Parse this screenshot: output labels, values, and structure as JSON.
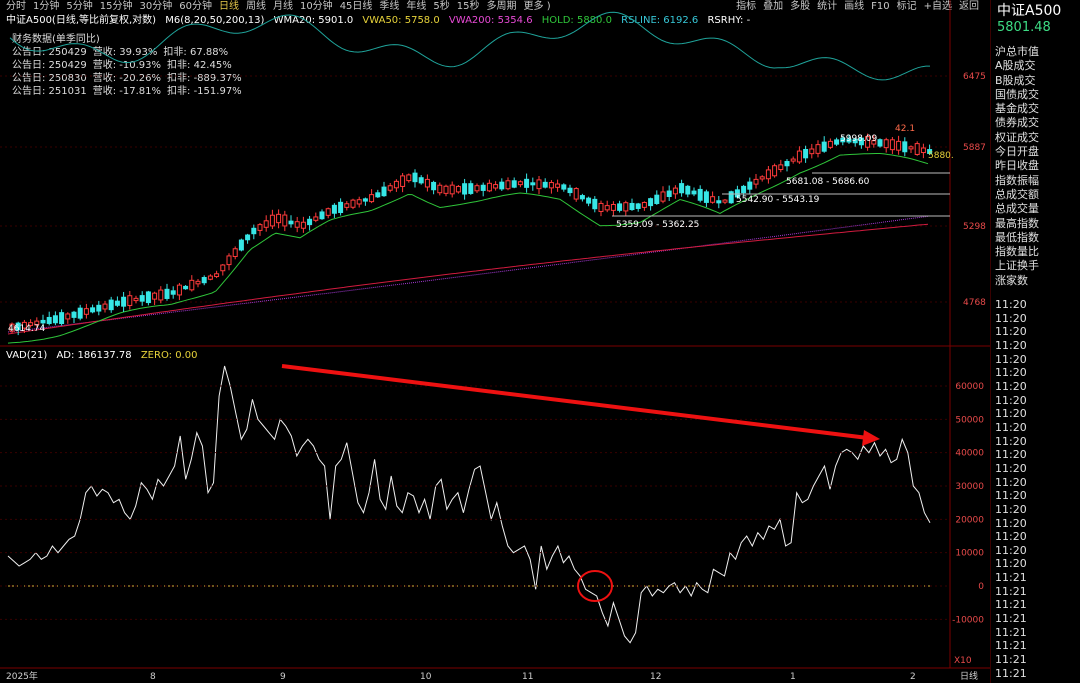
{
  "toolbar": {
    "left": [
      "分时",
      "1分钟",
      "5分钟",
      "15分钟",
      "30分钟",
      "60分钟",
      "日线",
      "周线",
      "月线",
      "10分钟",
      "45日线",
      "季线",
      "年线",
      "5秒",
      "15秒",
      "多周期",
      "更多 )"
    ],
    "active": "日线",
    "right": [
      "指标",
      "叠加",
      "多股",
      "统计",
      "画线",
      "F10",
      "标记",
      "+自选",
      "返回"
    ]
  },
  "info": {
    "name": "中证A500(日线,等比前复权,对数)",
    "m6": "M6(8,20,50,200,13)",
    "wma20": "WMA20: 5901.0",
    "vwa50": "VWA50: 5758.0",
    "vwa200": "VWA200: 5354.6",
    "hold": "HOLD: 5880.0",
    "rsline": "RSLINE: 6192.6",
    "rsrhy": "RSRHY: -"
  },
  "financial": {
    "header": "财务数据(单季同比)",
    "rows": [
      [
        "公告日: 250429",
        "营收: 39.93%",
        "扣非: 67.88%"
      ],
      [
        "公告日: 250429",
        "营收: -10.93%",
        "扣非: 42.45%"
      ],
      [
        "公告日: 250830",
        "营收: -20.26%",
        "扣非: -889.37%"
      ],
      [
        "公告日: 251031",
        "营收: -17.81%",
        "扣非: -151.97%"
      ]
    ]
  },
  "price_axis": [
    "6475",
    "5887",
    "5298",
    "4768"
  ],
  "annotations": {
    "low": "4614.74",
    "high": "5998.09",
    "marker": "42.1",
    "hold_tag": "5880.",
    "r1": "5681.08 - 5686.60",
    "r2": "5542.90 - 5543.19",
    "r3": "5359.09 - 5362.25"
  },
  "vad": {
    "name": "VAD(21)",
    "ad": "AD: 186137.78",
    "zero": "ZERO: 0.00",
    "axis": [
      "60000",
      "50000",
      "40000",
      "30000",
      "20000",
      "10000",
      "0",
      "-10000"
    ],
    "unit": "X10"
  },
  "xaxis": [
    "2025年",
    "8",
    "9",
    "10",
    "11",
    "12",
    "1",
    "2"
  ],
  "xaxis_right": "日线",
  "right_panel": {
    "title": "中证A500",
    "price": "5801.48",
    "items": [
      "沪总市值",
      "A股成交",
      "B股成交",
      "国债成交",
      "基金成交",
      "债券成交",
      "权证成交",
      "今日开盘",
      "昨日收盘",
      "指数振幅",
      "总成交额",
      "总成交量",
      "最高指数",
      "最低指数",
      "指数量比",
      "上证换手",
      "涨家数"
    ],
    "times": [
      "11:20",
      "11:20",
      "11:20",
      "11:20",
      "11:20",
      "11:20",
      "11:20",
      "11:20",
      "11:20",
      "11:20",
      "11:20",
      "11:20",
      "11:20",
      "11:20",
      "11:20",
      "11:20",
      "11:20",
      "11:20",
      "11:20",
      "11:20",
      "11:21",
      "11:21",
      "11:21",
      "11:21",
      "11:21",
      "11:21",
      "11:21",
      "11:21"
    ]
  },
  "colors": {
    "up": "#ff3b3b",
    "down": "#37e6e6",
    "teal": "#1fa39a",
    "green": "#2fc53a",
    "red_ma": "#d11b3f",
    "purple": "#a63ad6",
    "arrow": "#e11"
  },
  "chart_data": {
    "type": "line",
    "vad_series": [
      9000,
      7500,
      6000,
      7000,
      8000,
      10000,
      8000,
      9000,
      12000,
      10000,
      12000,
      14000,
      15000,
      20000,
      28000,
      30000,
      27000,
      29000,
      28000,
      25000,
      26000,
      22000,
      20000,
      24000,
      31000,
      29000,
      26000,
      32000,
      30000,
      33000,
      36000,
      45000,
      32000,
      38000,
      46000,
      42000,
      28000,
      31000,
      57000,
      66000,
      60000,
      52000,
      44000,
      47000,
      56000,
      50000,
      48000,
      46000,
      44000,
      50000,
      48000,
      45000,
      39000,
      42000,
      44000,
      42000,
      38000,
      36000,
      20000,
      36000,
      38000,
      43000,
      34000,
      25000,
      22000,
      28000,
      38000,
      26000,
      23000,
      33000,
      24000,
      22000,
      28000,
      27000,
      22000,
      26000,
      20000,
      30000,
      32000,
      23000,
      26000,
      28000,
      22000,
      29000,
      35000,
      36000,
      28000,
      20000,
      25000,
      18000,
      12000,
      10000,
      11000,
      12000,
      8000,
      -1000,
      12000,
      5000,
      9000,
      12000,
      7000,
      9000,
      5000,
      3000,
      -1000,
      -2000,
      -3000,
      -8000,
      -12000,
      -5000,
      -10000,
      -15000,
      -17000,
      -14000,
      -2000,
      0,
      -3000,
      -1000,
      -2000,
      0,
      1000,
      -2000,
      0,
      -3000,
      1000,
      -1000,
      -2000,
      5000,
      4000,
      3000,
      10000,
      8000,
      13000,
      15000,
      12000,
      16000,
      14000,
      18000,
      17000,
      20000,
      12000,
      13000,
      28000,
      25000,
      26000,
      30000,
      33000,
      36000,
      29000,
      36000,
      40000,
      41000,
      40000,
      38000,
      42000,
      40000,
      43000,
      39000,
      41000,
      37000,
      38000,
      44000,
      40000,
      30000,
      28000,
      22000,
      19000
    ],
    "zero": 0,
    "ylim": [
      -23000,
      70000
    ]
  }
}
